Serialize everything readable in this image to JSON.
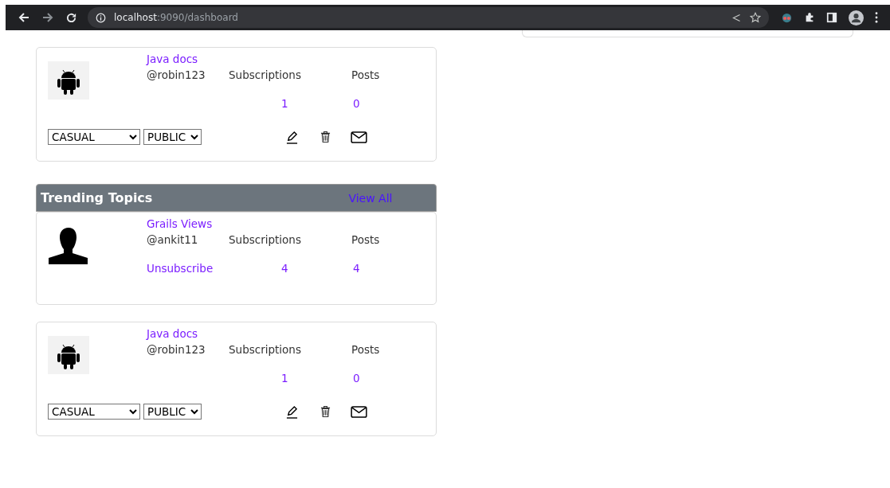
{
  "browser": {
    "host": "localhost",
    "path": ":9090/dashboard"
  },
  "top_topic": {
    "kind": "owned",
    "avatar": {
      "kind": "android"
    },
    "title": "Java docs",
    "handle": "@robin123",
    "subscriptions_label": "Subscriptions",
    "posts_label": "Posts",
    "subscriptions": "1",
    "posts": "0",
    "seriousness": "CASUAL",
    "visibility": "PUBLIC"
  },
  "trending": {
    "title": "Trending Topics",
    "view_all": "View All",
    "topics": [
      {
        "kind": "subscribed",
        "avatar": {
          "kind": "person"
        },
        "title": "Grails Views",
        "handle": "@ankit11",
        "subscriptions_label": "Subscriptions",
        "posts_label": "Posts",
        "subscriptions": "4",
        "posts": "4",
        "action": "Unsubscribe"
      },
      {
        "kind": "owned",
        "avatar": {
          "kind": "android"
        },
        "title": "Java docs",
        "handle": "@robin123",
        "subscriptions_label": "Subscriptions",
        "posts_label": "Posts",
        "subscriptions": "1",
        "posts": "0",
        "seriousness": "CASUAL",
        "visibility": "PUBLIC"
      }
    ]
  }
}
